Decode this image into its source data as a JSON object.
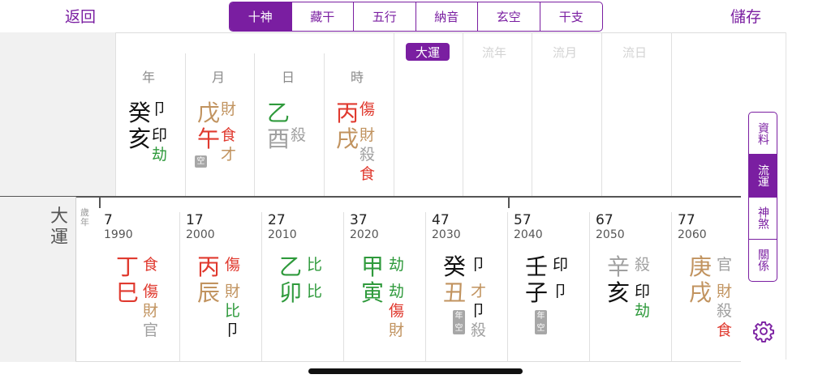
{
  "nav": {
    "back": "返回",
    "save": "儲存"
  },
  "tabs": [
    "十神",
    "藏干",
    "五行",
    "納音",
    "玄空",
    "干支"
  ],
  "pillars": [
    {
      "label": "年",
      "stem": "癸",
      "branch": "亥",
      "stem_god": "卩",
      "branch_gods": [
        "印",
        "劫"
      ],
      "empty_badge": ""
    },
    {
      "label": "月",
      "stem": "戊",
      "branch": "午",
      "stem_god": "財",
      "branch_gods": [
        "食",
        "才"
      ],
      "empty_badge": "空"
    },
    {
      "label": "日",
      "stem": "乙",
      "branch": "酉",
      "stem_god": "",
      "branch_gods": [
        "殺"
      ],
      "empty_badge": ""
    },
    {
      "label": "時",
      "stem": "丙",
      "branch": "戌",
      "stem_god": "傷",
      "branch_gods": [
        "財",
        "殺",
        "食"
      ],
      "empty_badge": ""
    }
  ],
  "period_tabs": {
    "active": "大運",
    "others": [
      "流年",
      "流月",
      "流日"
    ]
  },
  "side_tabs": [
    "資料",
    "流運",
    "神煞",
    "關係"
  ],
  "dayun": {
    "title": "大運",
    "age_year_label": "歲年",
    "items": [
      {
        "age": "7",
        "year": "1990",
        "stem": "丁",
        "branch": "巳",
        "stem_god": "食",
        "branch_gods": [
          "傷",
          "財",
          "官"
        ]
      },
      {
        "age": "17",
        "year": "2000",
        "stem": "丙",
        "branch": "辰",
        "stem_god": "傷",
        "branch_gods": [
          "財",
          "比",
          "卩"
        ]
      },
      {
        "age": "27",
        "year": "2010",
        "stem": "乙",
        "branch": "卯",
        "stem_god": "比",
        "branch_gods": [
          "比"
        ]
      },
      {
        "age": "37",
        "year": "2020",
        "stem": "甲",
        "branch": "寅",
        "stem_god": "劫",
        "branch_gods": [
          "劫",
          "傷",
          "財"
        ]
      },
      {
        "age": "47",
        "year": "2030",
        "stem": "癸",
        "branch": "丑",
        "stem_god": "卩",
        "branch_gods": [
          "才",
          "卩",
          "殺"
        ],
        "badge": "年空"
      },
      {
        "age": "57",
        "year": "2040",
        "stem": "壬",
        "branch": "子",
        "stem_god": "印",
        "branch_gods": [
          "卩"
        ],
        "badge": "年空"
      },
      {
        "age": "67",
        "year": "2050",
        "stem": "辛",
        "branch": "亥",
        "stem_god": "殺",
        "branch_gods": [
          "印",
          "劫"
        ]
      },
      {
        "age": "77",
        "year": "2060",
        "stem": "庚",
        "branch": "戌",
        "stem_god": "官",
        "branch_gods": [
          "財",
          "殺",
          "食"
        ]
      }
    ]
  },
  "colors": {
    "accent": "#7a1ea1",
    "red": "#e03a2f",
    "green": "#2f9a3c",
    "tan": "#c1935f",
    "gray": "#a0a0a0",
    "black": "#111111"
  }
}
